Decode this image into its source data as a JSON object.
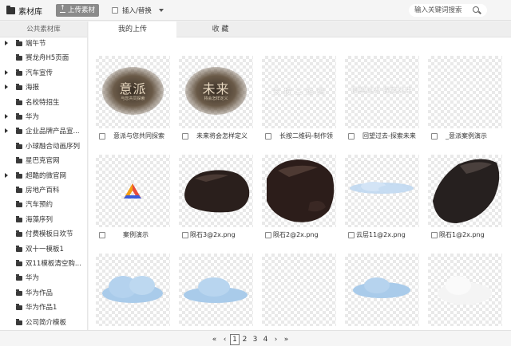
{
  "topbar": {
    "title": "素材库",
    "upload_label": "上传素材",
    "insert_label": "插入/替换",
    "search_placeholder": "输入关键词搜索"
  },
  "sidebar": {
    "header": "公共素材库",
    "items": [
      {
        "label": "端午节",
        "expandable": true
      },
      {
        "label": "赛龙舟H5页面",
        "expandable": false
      },
      {
        "label": "汽车宣传",
        "expandable": true
      },
      {
        "label": "海报",
        "expandable": true
      },
      {
        "label": "名校特招生",
        "expandable": false
      },
      {
        "label": "华为",
        "expandable": true
      },
      {
        "label": "企业品牌产品宣...",
        "expandable": true
      },
      {
        "label": "小球融合动画序列",
        "expandable": false
      },
      {
        "label": "星巴克官网",
        "expandable": false
      },
      {
        "label": "超酷的微官网",
        "expandable": true
      },
      {
        "label": "房地产百科",
        "expandable": false
      },
      {
        "label": "汽车预约",
        "expandable": false
      },
      {
        "label": "海藻序列",
        "expandable": false
      },
      {
        "label": "付费模板日欢节",
        "expandable": false
      },
      {
        "label": "双十一模板1",
        "expandable": false
      },
      {
        "label": "双11模板清空购...",
        "expandable": false
      },
      {
        "label": "华为",
        "expandable": false
      },
      {
        "label": "华为作品",
        "expandable": false
      },
      {
        "label": "华为作品1",
        "expandable": false
      },
      {
        "label": "公司简介模板",
        "expandable": false
      }
    ]
  },
  "tabs": [
    {
      "label": "我的上传",
      "active": true
    },
    {
      "label": "收 藏",
      "active": false
    }
  ],
  "grid": {
    "row1": [
      {
        "caption": "意派与您共同探索",
        "thumb_text": "意派",
        "thumb_sub": "与您共同探索"
      },
      {
        "caption": "未来将会怎样定义",
        "thumb_text": "未来",
        "thumb_sub": "将会怎样定义"
      },
      {
        "caption": "长按二维码-制作领",
        "thumb_text": "长 按 二 维 码"
      },
      {
        "caption": "回望过去-探索未来",
        "thumb_text": "回望过去 探索未来"
      },
      {
        "caption": "_意派案例演示",
        "thumb_text": ""
      }
    ],
    "row2": [
      {
        "caption": "案例演示"
      },
      {
        "caption": "陨石3@2x.png"
      },
      {
        "caption": "陨石2@2x.png"
      },
      {
        "caption": "云层11@2x.png"
      },
      {
        "caption": "陨石1@2x.png"
      }
    ]
  },
  "pager": {
    "first": "«",
    "prev": "‹",
    "pages": [
      "1",
      "2",
      "3",
      "4"
    ],
    "current": "1",
    "next": "›",
    "last": "»"
  },
  "colors": {
    "logo_red": "#e74c3c",
    "logo_blue": "#3b5bdb",
    "logo_orange": "#f39c12",
    "rock_dark": "#2a1f1c",
    "cloud_blue": "#a9cbea"
  }
}
